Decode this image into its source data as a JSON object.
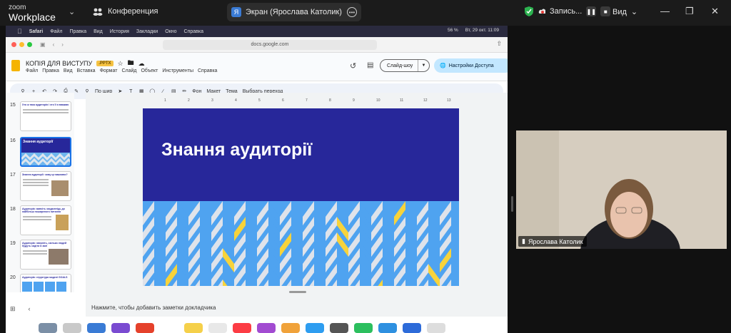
{
  "zoom": {
    "logo_top": "zoom",
    "logo_bottom": "Workplace",
    "meeting_label": "Конференция",
    "screen_share_label": "Экран (Ярослава Католик)",
    "screen_share_avatar": "Я",
    "recording_label": "Запись...",
    "view_label": "Вид"
  },
  "mac_menu": {
    "app": "Safari",
    "items": [
      "Файл",
      "Правка",
      "Вид",
      "История",
      "Закладки",
      "Окно",
      "Справка"
    ],
    "status": [
      "56 %",
      "Вт, 29 окт. 11:09"
    ]
  },
  "browser": {
    "url": "docs.google.com"
  },
  "docs": {
    "title": "КОПІЯ ДЛЯ ВИСТУПУ",
    "badge": ".PPTX",
    "menu": [
      "Файл",
      "Правка",
      "Вид",
      "Вставка",
      "Формат",
      "Слайд",
      "Объект",
      "Инструменты",
      "Справка"
    ],
    "slideshow_label": "Слайд-шоу",
    "share_label": "Настройки Доступа",
    "toolbar": {
      "zoom": "По шир",
      "bg": "Фон",
      "layout": "Макет",
      "theme": "Тема",
      "transition": "Выбрать переход"
    }
  },
  "filmstrip": [
    {
      "num": "15",
      "title": "Хто ж така аудиторія і хто її я вважаю"
    },
    {
      "num": "16",
      "title": "Знання аудиторії"
    },
    {
      "num": "17",
      "title": "Знання аудиторії: чому це важливо?"
    },
    {
      "num": "18",
      "title": "Аудиторія: вивчіть заздалегідь до найбільш поширеного питання"
    },
    {
      "num": "19",
      "title": "Аудиторія: зверніть, скільки людей будуть сидіти в залі"
    },
    {
      "num": "20",
      "title": "Аудиторія: структура моделі GOALS"
    }
  ],
  "slide": {
    "title": "Знання аудиторії"
  },
  "notes_placeholder": "Нажмите, чтобы добавить заметки докладчика",
  "ruler": [
    "1",
    "2",
    "3",
    "4",
    "5",
    "6",
    "7",
    "8",
    "9",
    "10",
    "11",
    "12",
    "13"
  ],
  "video": {
    "name": "Ярослава Католик"
  },
  "colors": {
    "slide_bg": "#27279a",
    "chevron_blue": "#4fa3f0",
    "chevron_yellow": "#f7d33b",
    "share_blue": "#c2e7ff"
  }
}
